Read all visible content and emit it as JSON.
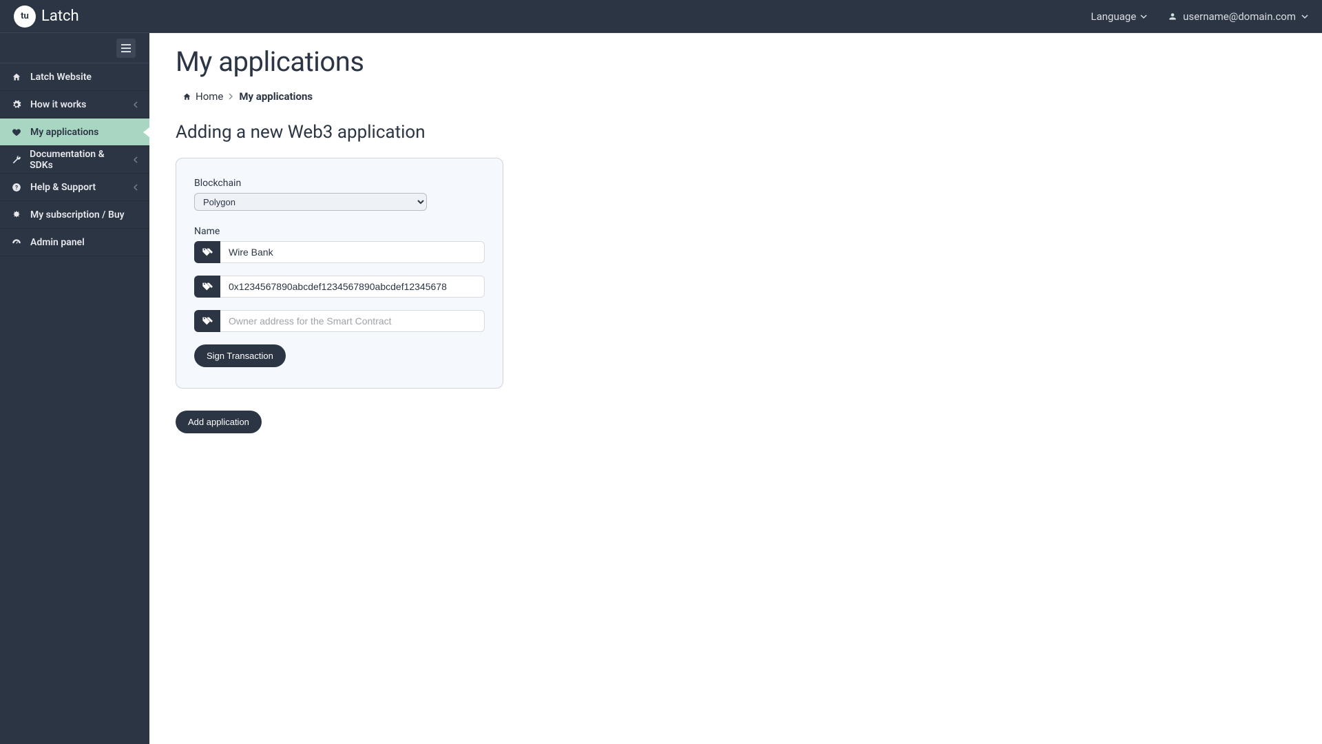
{
  "brand": {
    "logo_text": "tu",
    "name": "Latch"
  },
  "topbar": {
    "language_label": "Language",
    "username": "username@domain.com"
  },
  "sidebar": {
    "items": [
      {
        "label": "Latch Website",
        "icon": "home-icon",
        "expandable": false
      },
      {
        "label": "How it works",
        "icon": "gears-icon",
        "expandable": true
      },
      {
        "label": "My applications",
        "icon": "heart-icon",
        "expandable": false,
        "active": true
      },
      {
        "label": "Documentation & SDKs",
        "icon": "wrench-icon",
        "expandable": true
      },
      {
        "label": "Help & Support",
        "icon": "question-icon",
        "expandable": true
      },
      {
        "label": "My subscription / Buy",
        "icon": "certificate-icon",
        "expandable": false
      },
      {
        "label": "Admin panel",
        "icon": "dashboard-icon",
        "expandable": false
      }
    ]
  },
  "page": {
    "title": "My applications",
    "breadcrumb_home": "Home",
    "breadcrumb_current": "My applications",
    "subheading": "Adding a new Web3 application"
  },
  "form": {
    "blockchain_label": "Blockchain",
    "blockchain_value": "Polygon",
    "name_label": "Name",
    "name_value": "Wire Bank",
    "contract_value": "0x1234567890abcdef1234567890abcdef12345678",
    "owner_value": "",
    "owner_placeholder": "Owner address for the Smart Contract",
    "sign_button": "Sign Transaction",
    "add_button": "Add application"
  }
}
